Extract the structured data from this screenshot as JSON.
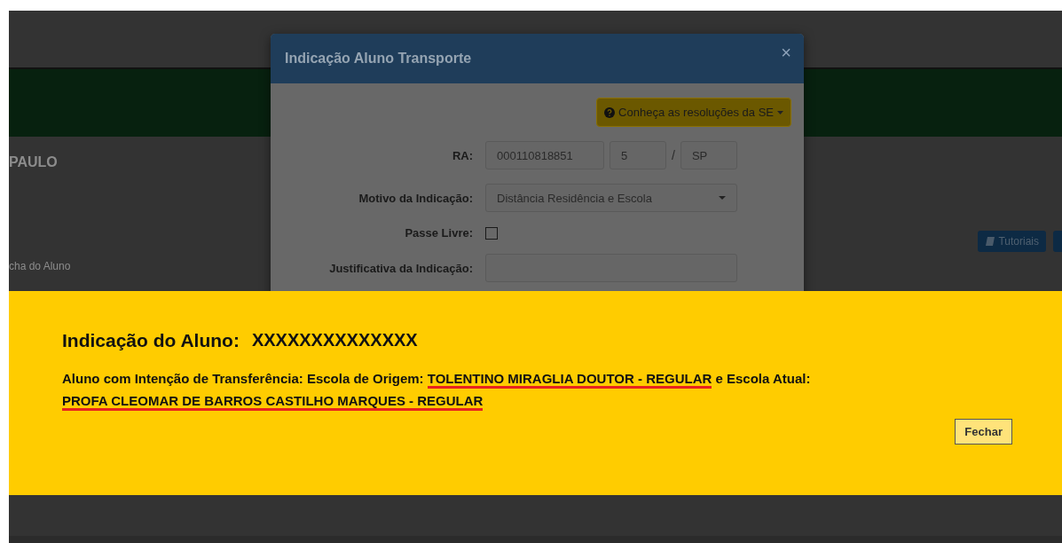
{
  "page": {
    "heading": "PAULO",
    "breadcrumb": "cha do Aluno",
    "buttons": [
      {
        "label": "Tutoriais"
      }
    ]
  },
  "modal": {
    "title": "Indicação Aluno Transporte",
    "close": "×",
    "resolutions_button": "Conheça as resoluções da SE",
    "ra": {
      "label": "RA:",
      "number": "000110818851",
      "digit": "5",
      "separator": "/",
      "state": "SP"
    },
    "reason": {
      "label": "Motivo da Indicação:",
      "value": "Distância Residência e Escola"
    },
    "free_pass": {
      "label": "Passe Livre:",
      "checked": false
    },
    "justification": {
      "label": "Justificativa da Indicação:"
    }
  },
  "alert": {
    "title": "Indicação do Aluno:",
    "student": "XXXXXXXXXXXXXX",
    "message": [
      {
        "text": "Aluno com Intenção de Transferência: Escola de Origem: ",
        "highlighted": false
      },
      {
        "text": "TOLENTINO MIRAGLIA DOUTOR - REGULAR",
        "highlighted": true
      },
      {
        "text": " e Escola Atual: ",
        "highlighted": false
      },
      {
        "text": "PROFA CLEOMAR DE BARROS CASTILHO MARQUES - REGULAR",
        "highlighted": true
      }
    ],
    "close_button": "Fechar"
  }
}
